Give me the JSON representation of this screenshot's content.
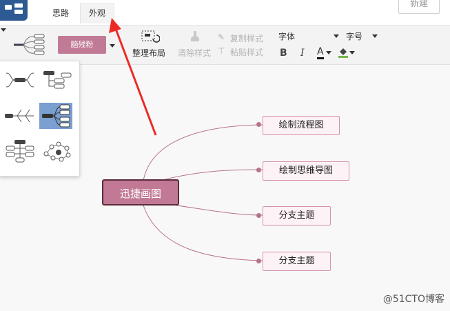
{
  "tabs": [
    {
      "label": "思路"
    },
    {
      "label": "外观"
    }
  ],
  "new_button": "新建",
  "toolbar": {
    "style_name": "脑残粉",
    "arrange_label": "整理布局",
    "clear_style_label": "清除样式",
    "copy_style_label": "复制样式",
    "paste_style_label": "粘贴样式",
    "font_label": "字体",
    "size_label": "字号",
    "bold": "B",
    "italic": "I",
    "font_color": "A"
  },
  "mindmap": {
    "center": "迅捷画图",
    "branches": [
      {
        "label": "绘制流程图"
      },
      {
        "label": "绘制思维导图"
      },
      {
        "label": "分支主题"
      },
      {
        "label": "分支主题"
      }
    ]
  },
  "colors": {
    "theme": "#c17a95",
    "center_border": "#5b2b3b",
    "branch_fill": "#fdf2f6",
    "branch_border": "#d690ab",
    "line": "#b67488",
    "arrow": "#ee2a24",
    "logo": "#2e5a93"
  },
  "layout_options": [
    {
      "icon": "mindmap-layout-icon"
    },
    {
      "icon": "org-right-layout-icon"
    },
    {
      "icon": "fishbone-layout-icon"
    },
    {
      "icon": "right-map-layout-icon",
      "selected": true
    },
    {
      "icon": "org-tree-layout-icon"
    },
    {
      "icon": "bubble-layout-icon"
    }
  ],
  "watermark": "@51CTO博客"
}
